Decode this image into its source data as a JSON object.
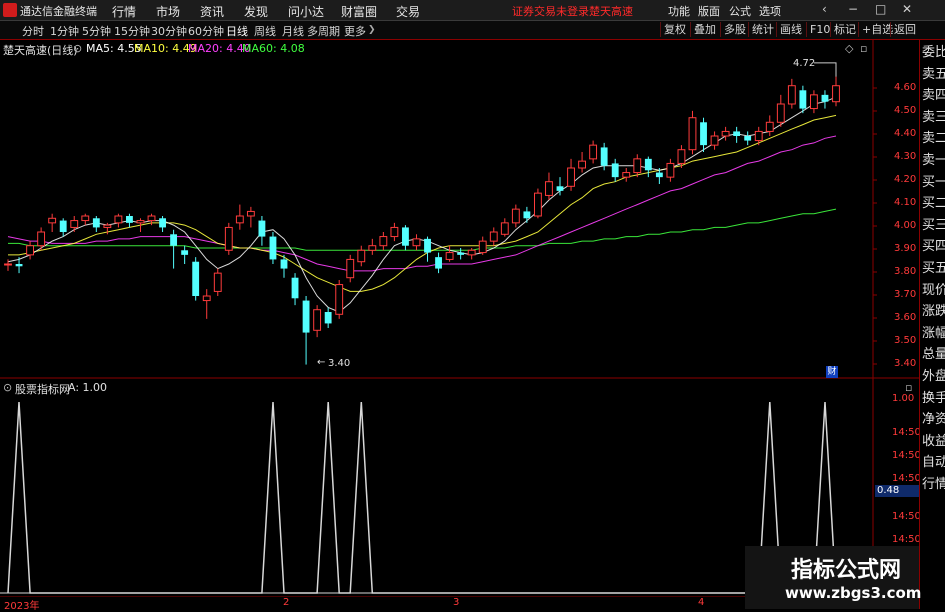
{
  "titlebar": {
    "app_name": "通达信金融终端",
    "menus": [
      "行情",
      "市场",
      "资讯",
      "发现",
      "问小达",
      "财富圈",
      "交易"
    ],
    "notice_left": "证券交易未登录",
    "notice_right": "楚天高速",
    "right_menus": [
      "功能",
      "版面",
      "公式",
      "选项"
    ],
    "window_controls": [
      "‹",
      "−",
      "□",
      "✕"
    ]
  },
  "toolbar": {
    "periods": [
      "分时",
      "1分钟",
      "5分钟",
      "15分钟",
      "30分钟",
      "60分钟",
      "日线",
      "周线",
      "月线",
      "多周期",
      "更多"
    ],
    "active_period": "日线",
    "right_buttons": [
      "复权",
      "叠加",
      "多股",
      "统计",
      "画线",
      "F10",
      "标记",
      "+自选",
      "返回"
    ]
  },
  "chart_info": {
    "stock_title": "楚天高速(日线)",
    "ma5": "MA5: 4.55",
    "ma10": "MA10: 4.49",
    "ma20": "MA20: 4.40",
    "ma60": "MA60: 4.08",
    "colors": {
      "ma5": "#ffffff",
      "ma10": "#ffff40",
      "ma20": "#ff40ff",
      "ma60": "#40ff40"
    }
  },
  "indicator_info": {
    "name": "股票指标网",
    "value": "A: 1.00"
  },
  "price_axis": [
    "4.60",
    "4.50",
    "4.40",
    "4.30",
    "4.20",
    "4.10",
    "4.00",
    "3.90",
    "3.80",
    "3.70",
    "3.60",
    "3.50",
    "3.40"
  ],
  "indicator_axis": [
    "1.00",
    "14:50",
    "14:50",
    "14:50",
    "0.48",
    "14:50",
    "14:50",
    "14:50"
  ],
  "indicator_current": "0.48",
  "annotations": {
    "high": "4.72",
    "low": "3.40",
    "fin_badge": "财"
  },
  "side_list": [
    "委比",
    "卖五",
    "卖四",
    "卖三",
    "卖二",
    "卖一",
    "买一",
    "买二",
    "买三",
    "买四",
    "买五",
    "现价",
    "涨跌",
    "涨幅",
    "总量",
    "外盘",
    "换手",
    "净资",
    "收益",
    "自动",
    "行情"
  ],
  "date_axis": [
    "2023年",
    "2",
    "3",
    "4"
  ],
  "watermark": {
    "title": "指标公式网",
    "url": "www.zbgs3.com"
  },
  "chart_data": {
    "type": "candlestick",
    "ylim": [
      3.35,
      4.75
    ],
    "candles": [
      [
        3.84,
        3.84,
        3.86,
        3.81
      ],
      [
        3.84,
        3.83,
        3.87,
        3.8
      ],
      [
        3.88,
        3.92,
        3.94,
        3.86
      ],
      [
        3.92,
        3.98,
        4.0,
        3.9
      ],
      [
        4.02,
        4.04,
        4.06,
        3.98
      ],
      [
        4.03,
        3.98,
        4.04,
        3.96
      ],
      [
        4.0,
        4.03,
        4.05,
        3.98
      ],
      [
        4.03,
        4.05,
        4.06,
        4.01
      ],
      [
        4.04,
        4.0,
        4.05,
        3.98
      ],
      [
        4.0,
        4.01,
        4.02,
        3.97
      ],
      [
        4.02,
        4.05,
        4.06,
        4.0
      ],
      [
        4.05,
        4.02,
        4.06,
        4.0
      ],
      [
        4.02,
        4.03,
        4.04,
        3.98
      ],
      [
        4.03,
        4.05,
        4.06,
        4.01
      ],
      [
        4.04,
        4.0,
        4.05,
        3.98
      ],
      [
        3.97,
        3.92,
        3.99,
        3.82
      ],
      [
        3.9,
        3.88,
        3.92,
        3.84
      ],
      [
        3.85,
        3.7,
        3.87,
        3.68
      ],
      [
        3.68,
        3.7,
        3.73,
        3.6
      ],
      [
        3.72,
        3.8,
        3.82,
        3.7
      ],
      [
        3.9,
        4.0,
        4.02,
        3.88
      ],
      [
        4.02,
        4.05,
        4.1,
        3.99
      ],
      [
        4.05,
        4.07,
        4.09,
        4.0
      ],
      [
        4.03,
        3.96,
        4.05,
        3.92
      ],
      [
        3.96,
        3.86,
        3.98,
        3.84
      ],
      [
        3.86,
        3.82,
        3.88,
        3.78
      ],
      [
        3.78,
        3.69,
        3.8,
        3.66
      ],
      [
        3.68,
        3.54,
        3.7,
        3.4
      ],
      [
        3.55,
        3.64,
        3.66,
        3.52
      ],
      [
        3.63,
        3.58,
        3.65,
        3.56
      ],
      [
        3.62,
        3.75,
        3.77,
        3.6
      ],
      [
        3.78,
        3.86,
        3.88,
        3.76
      ],
      [
        3.85,
        3.9,
        3.92,
        3.83
      ],
      [
        3.9,
        3.92,
        3.95,
        3.88
      ],
      [
        3.92,
        3.96,
        3.98,
        3.9
      ],
      [
        3.96,
        4.0,
        4.02,
        3.94
      ],
      [
        4.0,
        3.92,
        4.01,
        3.9
      ],
      [
        3.92,
        3.95,
        3.97,
        3.9
      ],
      [
        3.95,
        3.89,
        3.96,
        3.85
      ],
      [
        3.87,
        3.82,
        3.89,
        3.8
      ],
      [
        3.86,
        3.89,
        3.92,
        3.85
      ],
      [
        3.89,
        3.88,
        3.91,
        3.86
      ],
      [
        3.88,
        3.9,
        3.91,
        3.86
      ],
      [
        3.89,
        3.94,
        3.96,
        3.88
      ],
      [
        3.94,
        3.98,
        4.0,
        3.92
      ],
      [
        3.97,
        4.02,
        4.04,
        3.96
      ],
      [
        4.02,
        4.08,
        4.1,
        4.0
      ],
      [
        4.07,
        4.04,
        4.09,
        4.02
      ],
      [
        4.05,
        4.15,
        4.17,
        4.04
      ],
      [
        4.14,
        4.2,
        4.24,
        4.12
      ],
      [
        4.18,
        4.16,
        4.22,
        4.14
      ],
      [
        4.18,
        4.26,
        4.3,
        4.16
      ],
      [
        4.26,
        4.29,
        4.33,
        4.24
      ],
      [
        4.3,
        4.36,
        4.38,
        4.28
      ],
      [
        4.35,
        4.27,
        4.37,
        4.25
      ],
      [
        4.28,
        4.22,
        4.3,
        4.2
      ],
      [
        4.22,
        4.24,
        4.26,
        4.2
      ],
      [
        4.24,
        4.3,
        4.32,
        4.22
      ],
      [
        4.3,
        4.25,
        4.31,
        4.22
      ],
      [
        4.24,
        4.22,
        4.26,
        4.19
      ],
      [
        4.22,
        4.28,
        4.3,
        4.2
      ],
      [
        4.28,
        4.34,
        4.36,
        4.26
      ],
      [
        4.34,
        4.48,
        4.51,
        4.32
      ],
      [
        4.46,
        4.36,
        4.48,
        4.33
      ],
      [
        4.36,
        4.4,
        4.42,
        4.34
      ],
      [
        4.4,
        4.42,
        4.44,
        4.38
      ],
      [
        4.42,
        4.4,
        4.44,
        4.37
      ],
      [
        4.4,
        4.38,
        4.42,
        4.36
      ],
      [
        4.38,
        4.42,
        4.44,
        4.36
      ],
      [
        4.42,
        4.46,
        4.49,
        4.4
      ],
      [
        4.46,
        4.54,
        4.58,
        4.44
      ],
      [
        4.54,
        4.62,
        4.65,
        4.52
      ],
      [
        4.6,
        4.52,
        4.62,
        4.5
      ],
      [
        4.52,
        4.58,
        4.6,
        4.5
      ],
      [
        4.58,
        4.55,
        4.6,
        4.52
      ],
      [
        4.55,
        4.62,
        4.72,
        4.53
      ]
    ],
    "ma5": [
      3.85,
      3.86,
      3.88,
      3.91,
      3.94,
      3.96,
      3.99,
      4.01,
      4.02,
      4.01,
      4.02,
      4.03,
      4.02,
      4.03,
      4.03,
      4.01,
      3.98,
      3.92,
      3.86,
      3.82,
      3.84,
      3.87,
      3.92,
      3.98,
      3.99,
      3.95,
      3.88,
      3.78,
      3.7,
      3.65,
      3.63,
      3.67,
      3.73,
      3.79,
      3.86,
      3.92,
      3.94,
      3.95,
      3.94,
      3.92,
      3.9,
      3.89,
      3.88,
      3.89,
      3.91,
      3.94,
      3.99,
      4.03,
      4.07,
      4.12,
      4.16,
      4.19,
      4.23,
      4.26,
      4.27,
      4.27,
      4.27,
      4.27,
      4.26,
      4.25,
      4.26,
      4.28,
      4.31,
      4.34,
      4.37,
      4.4,
      4.41,
      4.4,
      4.41,
      4.42,
      4.45,
      4.48,
      4.51,
      4.54,
      4.55,
      4.57
    ],
    "ma10": [
      3.88,
      3.88,
      3.89,
      3.9,
      3.91,
      3.92,
      3.93,
      3.95,
      3.97,
      3.98,
      3.99,
      4.0,
      4.01,
      4.02,
      4.02,
      4.02,
      4.01,
      3.99,
      3.96,
      3.93,
      3.92,
      3.91,
      3.91,
      3.9,
      3.89,
      3.87,
      3.84,
      3.81,
      3.78,
      3.76,
      3.74,
      3.72,
      3.72,
      3.73,
      3.75,
      3.78,
      3.82,
      3.86,
      3.89,
      3.91,
      3.92,
      3.92,
      3.92,
      3.92,
      3.92,
      3.93,
      3.94,
      3.96,
      3.98,
      4.02,
      4.06,
      4.1,
      4.13,
      4.17,
      4.19,
      4.2,
      4.22,
      4.23,
      4.24,
      4.25,
      4.26,
      4.27,
      4.29,
      4.3,
      4.31,
      4.32,
      4.33,
      4.35,
      4.37,
      4.39,
      4.41,
      4.43,
      4.45,
      4.47,
      4.48,
      4.49
    ],
    "ma20": [
      3.96,
      3.95,
      3.94,
      3.94,
      3.93,
      3.93,
      3.93,
      3.93,
      3.94,
      3.94,
      3.95,
      3.95,
      3.96,
      3.96,
      3.96,
      3.96,
      3.96,
      3.95,
      3.94,
      3.93,
      3.92,
      3.91,
      3.91,
      3.9,
      3.9,
      3.89,
      3.88,
      3.86,
      3.84,
      3.83,
      3.82,
      3.81,
      3.81,
      3.81,
      3.82,
      3.82,
      3.82,
      3.83,
      3.83,
      3.84,
      3.84,
      3.84,
      3.84,
      3.85,
      3.86,
      3.87,
      3.88,
      3.9,
      3.92,
      3.94,
      3.96,
      3.98,
      4.0,
      4.02,
      4.04,
      4.06,
      4.08,
      4.1,
      4.12,
      4.14,
      4.16,
      4.17,
      4.19,
      4.21,
      4.23,
      4.24,
      4.26,
      4.28,
      4.29,
      4.31,
      4.33,
      4.34,
      4.36,
      4.37,
      4.39,
      4.4
    ],
    "ma60": [
      3.93,
      3.93,
      3.92,
      3.92,
      3.92,
      3.92,
      3.92,
      3.92,
      3.92,
      3.92,
      3.92,
      3.92,
      3.92,
      3.92,
      3.92,
      3.92,
      3.92,
      3.91,
      3.91,
      3.91,
      3.91,
      3.91,
      3.91,
      3.91,
      3.91,
      3.91,
      3.91,
      3.9,
      3.9,
      3.9,
      3.9,
      3.9,
      3.9,
      3.9,
      3.9,
      3.9,
      3.9,
      3.9,
      3.9,
      3.9,
      3.9,
      3.9,
      3.9,
      3.91,
      3.91,
      3.91,
      3.92,
      3.92,
      3.92,
      3.93,
      3.93,
      3.93,
      3.94,
      3.94,
      3.95,
      3.95,
      3.96,
      3.96,
      3.97,
      3.97,
      3.98,
      3.98,
      3.99,
      3.99,
      4.0,
      4.0,
      4.01,
      4.02,
      4.02,
      4.03,
      4.04,
      4.05,
      4.06,
      4.06,
      4.07,
      4.08
    ],
    "indicator": {
      "ylim": [
        0,
        1.0
      ],
      "spike_indices": [
        1,
        24,
        29,
        32,
        69,
        74
      ],
      "values_note": ""
    }
  }
}
